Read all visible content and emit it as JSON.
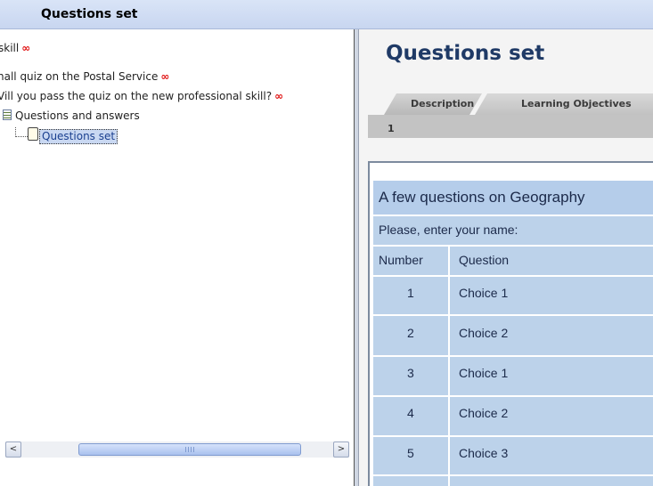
{
  "window": {
    "title": "Questions set"
  },
  "tree": {
    "items": [
      {
        "label": "skill",
        "has_infinity": true
      },
      {
        "label": "nall quiz on the Postal Service",
        "has_infinity": true
      },
      {
        "label": "Vill you pass the quiz on the new professional skill?",
        "has_infinity": true
      },
      {
        "label": "Questions and answers",
        "has_infinity": false
      }
    ],
    "selected_label": "Questions set",
    "infinity_symbol": "∞"
  },
  "scrollbar": {
    "left_arrow": "<",
    "right_arrow": ">"
  },
  "content": {
    "heading": "Questions set",
    "tabs": [
      {
        "label": "Description"
      },
      {
        "label": "Learning Objectives"
      }
    ],
    "tab_page_number": "1",
    "quiz": {
      "title": "A few questions on Geography",
      "prompt": "Please, enter your name:",
      "columns": [
        "Number",
        "Question"
      ],
      "rows": [
        {
          "number": "1",
          "question": "Choice 1"
        },
        {
          "number": "2",
          "question": "Choice 2"
        },
        {
          "number": "3",
          "question": "Choice 1"
        },
        {
          "number": "4",
          "question": "Choice 2"
        },
        {
          "number": "5",
          "question": "Choice 3"
        }
      ]
    }
  },
  "colors": {
    "heading": "#1f3a66",
    "infinity": "#e01010",
    "table_bg": "#b5cdea"
  }
}
